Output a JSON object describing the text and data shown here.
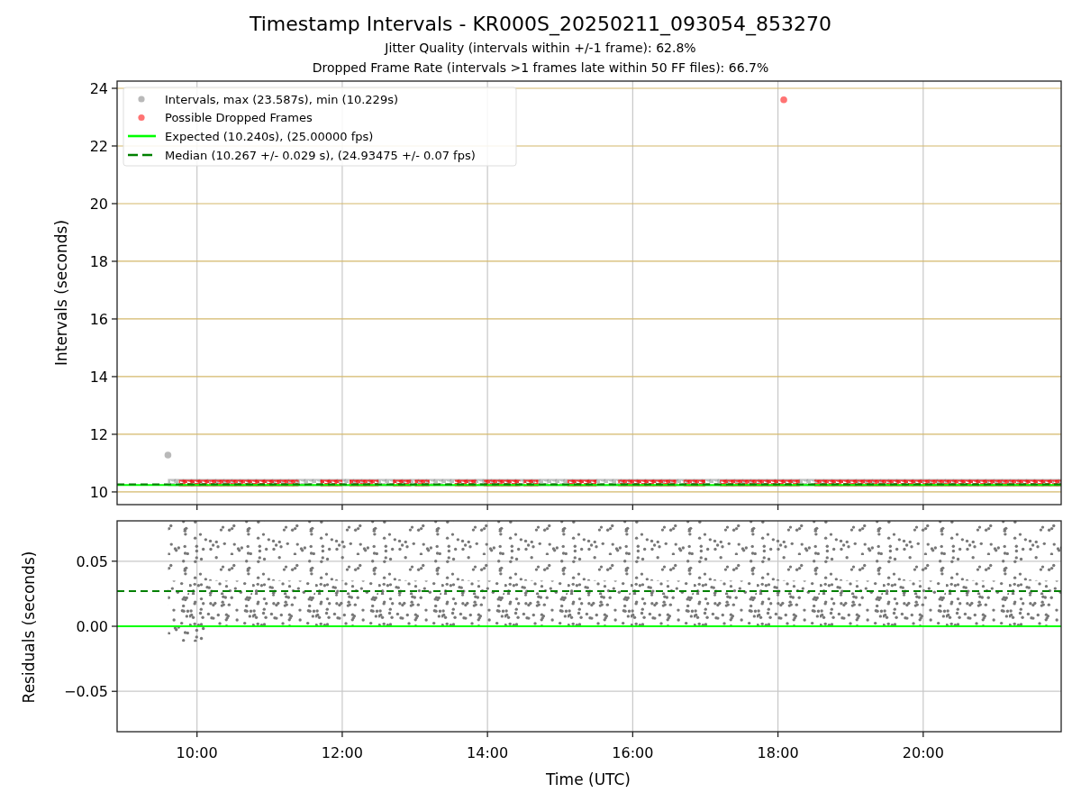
{
  "figure": {
    "title": "Timestamp Intervals - KR000S_20250211_093054_853270",
    "subtitles": [
      "Jitter Quality (intervals within +/-1 frame): 62.8%",
      "Dropped Frame Rate (intervals >1 frames late within 50 FF files): 66.7%"
    ]
  },
  "intervals_plot": {
    "chart_data": {
      "type": "scatter",
      "ylabel": "Intervals (seconds)",
      "xlim": [
        8.9,
        21.9
      ],
      "ylim": [
        9.56,
        24.25
      ],
      "grid": true,
      "legend": "upper left",
      "yticks": [
        {
          "value": 10,
          "label": "10"
        },
        {
          "value": 12,
          "label": "12"
        },
        {
          "value": 14,
          "label": "14"
        },
        {
          "value": 16,
          "label": "16"
        },
        {
          "value": 18,
          "label": "18"
        },
        {
          "value": 20,
          "label": "20"
        },
        {
          "value": 22,
          "label": "22"
        },
        {
          "value": 24,
          "label": "24"
        }
      ],
      "series": [
        {
          "name": "Intervals, max (23.587s), min (10.229s)",
          "color": "#808080",
          "x": [
            9.6
          ],
          "values": [
            11.28
          ]
        },
        {
          "name": "Possible Dropped Frames",
          "color": "#ff0000",
          "x": [
            18.08
          ],
          "values": [
            23.6
          ]
        }
      ],
      "ref_lines": [
        {
          "axis": "y",
          "value": 10.24,
          "label": "Expected (10.240s), (25.00000 fps)",
          "color": "#00ff00"
        },
        {
          "axis": "y",
          "value": 10.267,
          "label": "Median (10.267 +/- 0.029 s), (24.93475 +/- 0.07 fps)",
          "color": "#008000"
        }
      ]
    }
  },
  "residuals_plot": {
    "chart_data": {
      "type": "scatter",
      "xlabel": "Time (UTC)",
      "ylabel": "Residuals (seconds)",
      "xlim": [
        8.9,
        21.9
      ],
      "ylim": [
        -0.081,
        0.081
      ],
      "grid": true,
      "xticks": [
        {
          "value": 10,
          "label": "10:00"
        },
        {
          "value": 12,
          "label": "12:00"
        },
        {
          "value": 14,
          "label": "14:00"
        },
        {
          "value": 16,
          "label": "16:00"
        },
        {
          "value": 18,
          "label": "18:00"
        },
        {
          "value": 20,
          "label": "20:00"
        }
      ],
      "yticks": [
        {
          "value": -0.05,
          "label": "−0.05"
        },
        {
          "value": 0,
          "label": "0.00"
        },
        {
          "value": 0.05,
          "label": "0.05"
        }
      ],
      "ref_lines": [
        {
          "axis": "y",
          "value": 0,
          "color": "#00ff00"
        },
        {
          "axis": "y",
          "value": 0.027,
          "color": "#008000"
        }
      ]
    }
  }
}
